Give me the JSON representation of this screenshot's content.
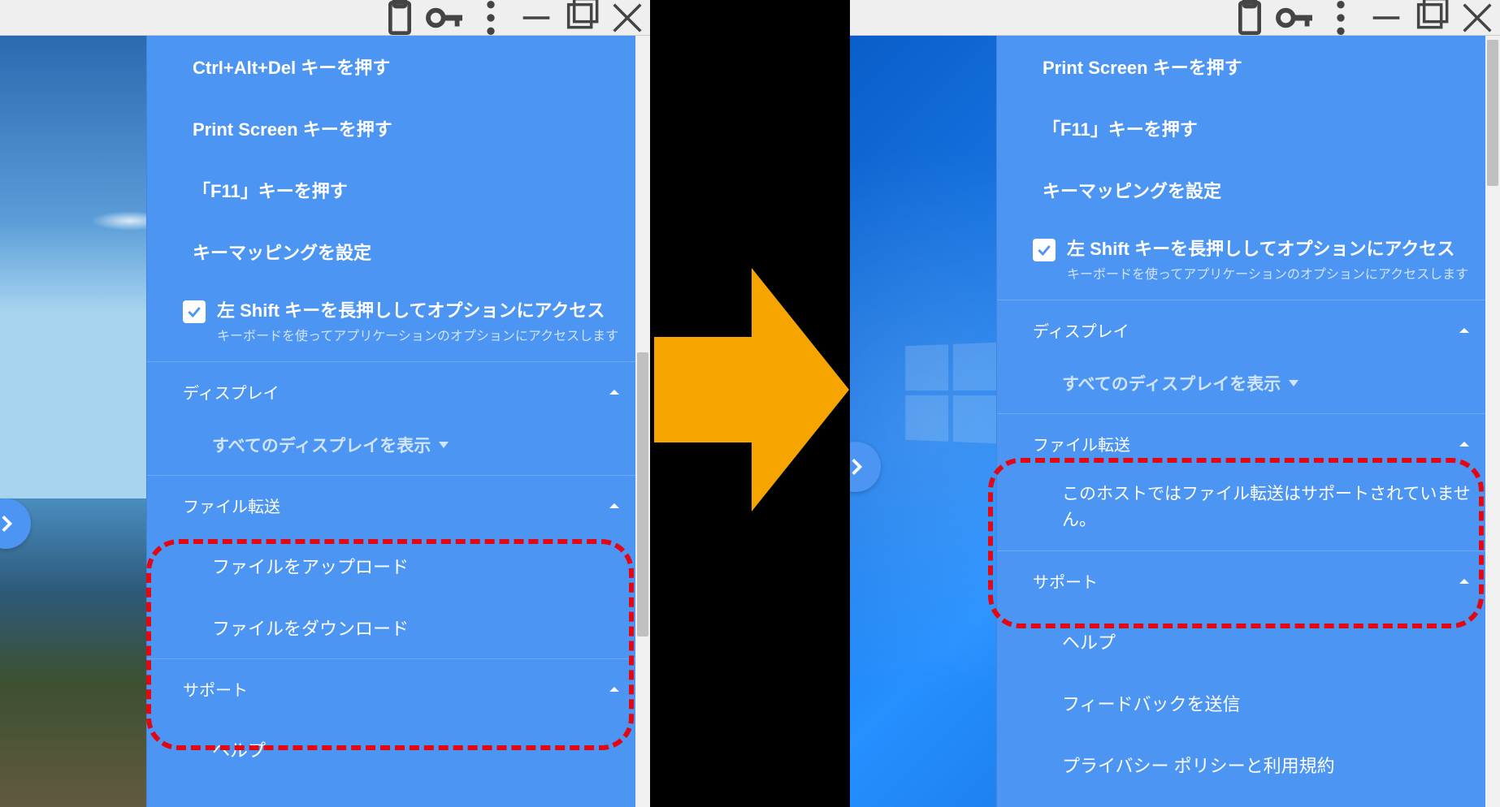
{
  "titlebar": {
    "clipboard": "clipboard",
    "key": "key",
    "more": "more",
    "minimize": "—",
    "maximize": "□",
    "close": "✕"
  },
  "left": {
    "items": {
      "ctrl_alt_del": "Ctrl+Alt+Del キーを押す",
      "print_screen": "Print Screen キーを押す",
      "f11": "「F11」キーを押す",
      "keymap": "キーマッピングを設定"
    },
    "shift_option": {
      "label": "左 Shift キーを長押ししてオプションにアクセス",
      "sub": "キーボードを使ってアプリケーションのオプションにアクセスします"
    },
    "display_header": "ディスプレイ",
    "display_all": "すべてのディスプレイを表示",
    "file_transfer_header": "ファイル転送",
    "file_upload": "ファイルをアップロード",
    "file_download": "ファイルをダウンロード",
    "support_header": "サポート",
    "help": "ヘルプ"
  },
  "right": {
    "items": {
      "print_screen": "Print Screen キーを押す",
      "f11": "「F11」キーを押す",
      "keymap": "キーマッピングを設定"
    },
    "shift_option": {
      "label": "左 Shift キーを長押ししてオプションにアクセス",
      "sub": "キーボードを使ってアプリケーションのオプションにアクセスします"
    },
    "display_header": "ディスプレイ",
    "display_all": "すべてのディスプレイを表示",
    "file_transfer_header": "ファイル転送",
    "file_transfer_msg": "このホストではファイル転送はサポートされていません。",
    "support_header": "サポート",
    "help": "ヘルプ",
    "feedback": "フィードバックを送信",
    "privacy": "プライバシー ポリシーと利用規約"
  },
  "highlight_color": "#e30613",
  "arrow_color": "#f5a400"
}
